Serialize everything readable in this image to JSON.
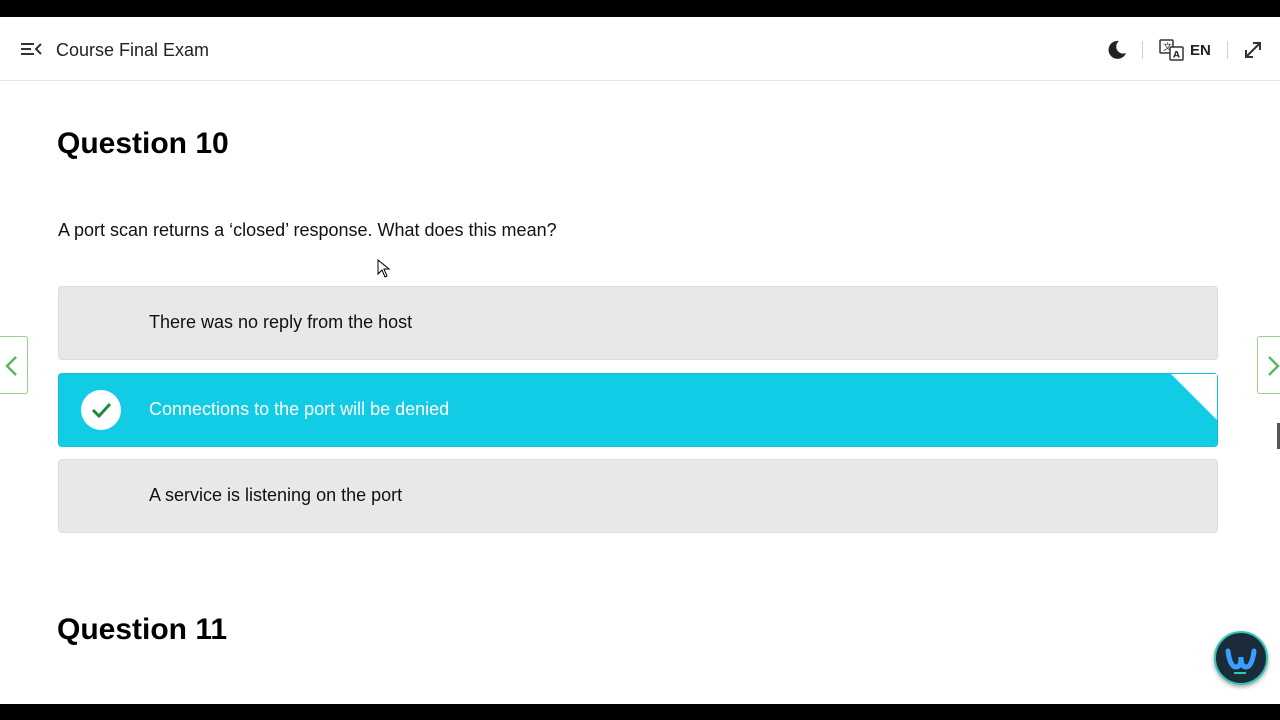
{
  "header": {
    "title": "Course Final Exam",
    "language": "EN",
    "icons": {
      "menu": "menu-collapse-icon",
      "theme": "moon-icon",
      "language": "translate-icon",
      "fullscreen": "expand-icon"
    }
  },
  "questions": [
    {
      "heading": "Question 10",
      "text": "A port scan returns a ‘closed’ response. What does this mean?",
      "options": [
        {
          "label": "There was no reply from the host",
          "selected": false
        },
        {
          "label": "Connections to the port will be denied",
          "selected": true
        },
        {
          "label": "A service is listening on the port",
          "selected": false
        }
      ]
    },
    {
      "heading": "Question 11"
    }
  ],
  "colors": {
    "selected_option": "#12cbe5",
    "option_background": "#e8e8e8",
    "nav_arrow": "#5cb85c",
    "check": "#1f8a3a"
  }
}
